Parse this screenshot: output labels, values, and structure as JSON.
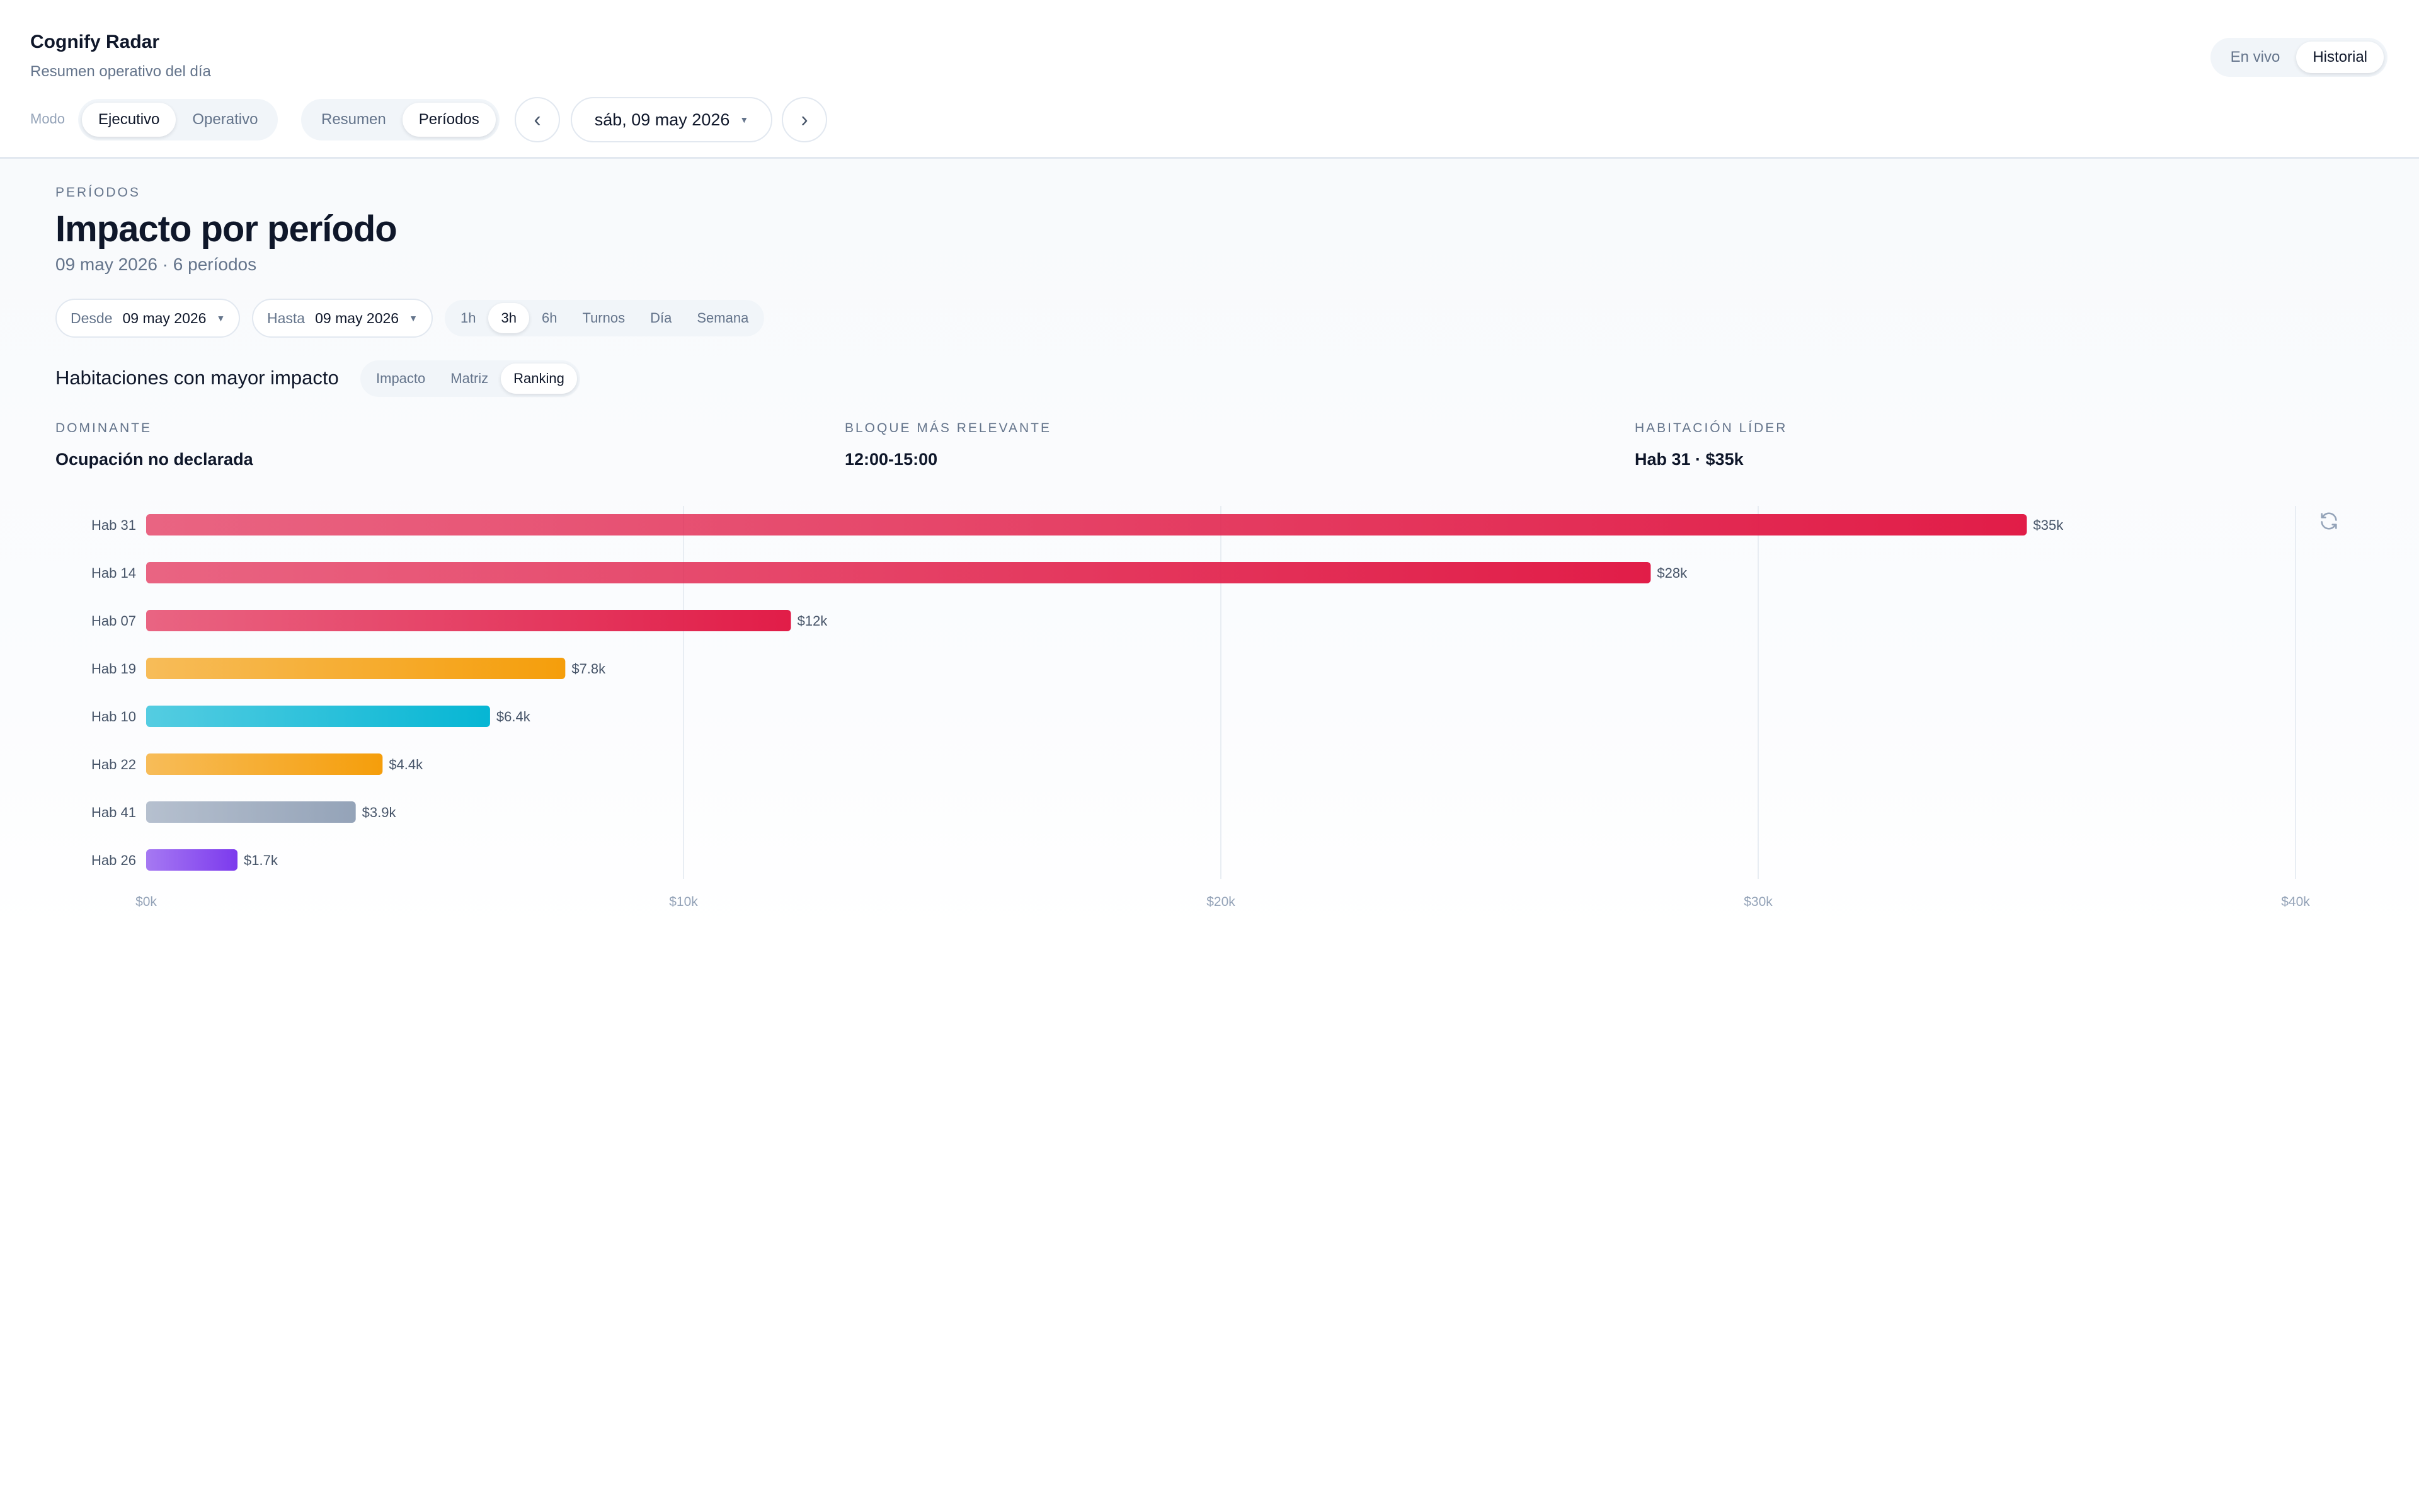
{
  "app": {
    "title": "Cognify Radar",
    "subtitle": "Resumen operativo del día"
  },
  "toolbar": {
    "mode_label": "Modo",
    "modes": [
      "Ejecutivo",
      "Operativo"
    ],
    "active_mode": "Ejecutivo",
    "views": [
      "Resumen",
      "Períodos"
    ],
    "active_view": "Períodos",
    "prev_icon": "chevron-left-icon",
    "next_icon": "chevron-right-icon",
    "prev_glyph": "‹",
    "next_glyph": "›",
    "date": "sáb, 09 may 2026",
    "live_options": [
      "En vivo",
      "Historial"
    ],
    "active_live": "Historial"
  },
  "main": {
    "eyebrow": "PERÍODOS",
    "title": "Impacto por período",
    "subtitle": "09 may 2026 · 6 períodos",
    "from_label": "Desde",
    "from_value": "09 may 2026",
    "to_label": "Hasta",
    "to_value": "09 may 2026",
    "granularities": [
      "1h",
      "3h",
      "6h",
      "Turnos",
      "Día",
      "Semana"
    ],
    "active_granularity": "3h",
    "section_title": "Habitaciones con mayor impacto",
    "chart_modes": [
      "Impacto",
      "Matriz",
      "Ranking"
    ],
    "active_chart_mode": "Ranking",
    "kpis": [
      {
        "label": "DOMINANTE",
        "value": "Ocupación no declarada"
      },
      {
        "label": "BLOQUE MÁS RELEVANTE",
        "value": "12:00-15:00"
      },
      {
        "label": "HABITACIÓN LÍDER",
        "value": "Hab 31 · $35k"
      }
    ],
    "refresh_icon": "refresh-icon"
  },
  "colors": {
    "crimson": "#e11d48",
    "amber": "#f59e0b",
    "cyan": "#06b6d4",
    "slate": "#94a3b8",
    "violet": "#7c3aed"
  },
  "chart_data": {
    "type": "bar",
    "orientation": "horizontal",
    "categories": [
      "Hab 31",
      "Hab 14",
      "Hab 07",
      "Hab 19",
      "Hab 10",
      "Hab 22",
      "Hab 41",
      "Hab 26"
    ],
    "values": [
      35000,
      28000,
      12000,
      7800,
      6400,
      4400,
      3900,
      1700
    ],
    "value_labels": [
      "$35k",
      "$28k",
      "$12k",
      "$7.8k",
      "$6.4k",
      "$4.4k",
      "$3.9k",
      "$1.7k"
    ],
    "bar_colors": [
      "crimson",
      "crimson",
      "crimson",
      "amber",
      "cyan",
      "amber",
      "slate",
      "violet"
    ],
    "xlim": [
      0,
      40000
    ],
    "xticks": [
      0,
      10000,
      20000,
      30000,
      40000
    ],
    "xtick_labels": [
      "$0k",
      "$10k",
      "$20k",
      "$30k",
      "$40k"
    ],
    "grid": true
  }
}
